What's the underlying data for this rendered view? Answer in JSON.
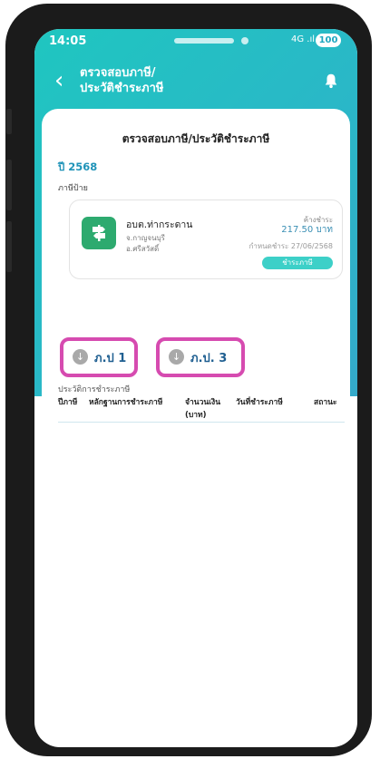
{
  "status_bar": {
    "time": "14:05",
    "battery": "100",
    "signal": "4G .ıl"
  },
  "header": {
    "title_line1": "ตรวจสอบภาษี/",
    "title_line2": "ประวัติชำระภาษี"
  },
  "main": {
    "title": "ตรวจสอบภาษี/ประวัติชำระภาษี",
    "year": "ปี 2568",
    "tax_type_label": "ภาษีป้าย",
    "tax_card": {
      "org_name": "อบต.ท่ากระดาน",
      "province": "จ.กาญจนบุรี",
      "district": "อ.ศรีสวัสดิ์",
      "outstanding_label": "ค้างชำระ",
      "outstanding_amount": "217.50 บาท",
      "due_date": "กำหนดชำระ 27/06/2568",
      "pay_button": "ชำระภาษี"
    },
    "download_buttons": [
      {
        "label": "ภ.ป 1"
      },
      {
        "label": "ภ.ป. 3"
      }
    ],
    "history": {
      "title": "ประวัติการชำระภาษี",
      "columns": [
        "ปีภาษี",
        "หลักฐานการชำระภาษี",
        "จำนวนเงิน (บาท)",
        "วันที่ชำระภาษี",
        "สถานะ"
      ]
    }
  }
}
